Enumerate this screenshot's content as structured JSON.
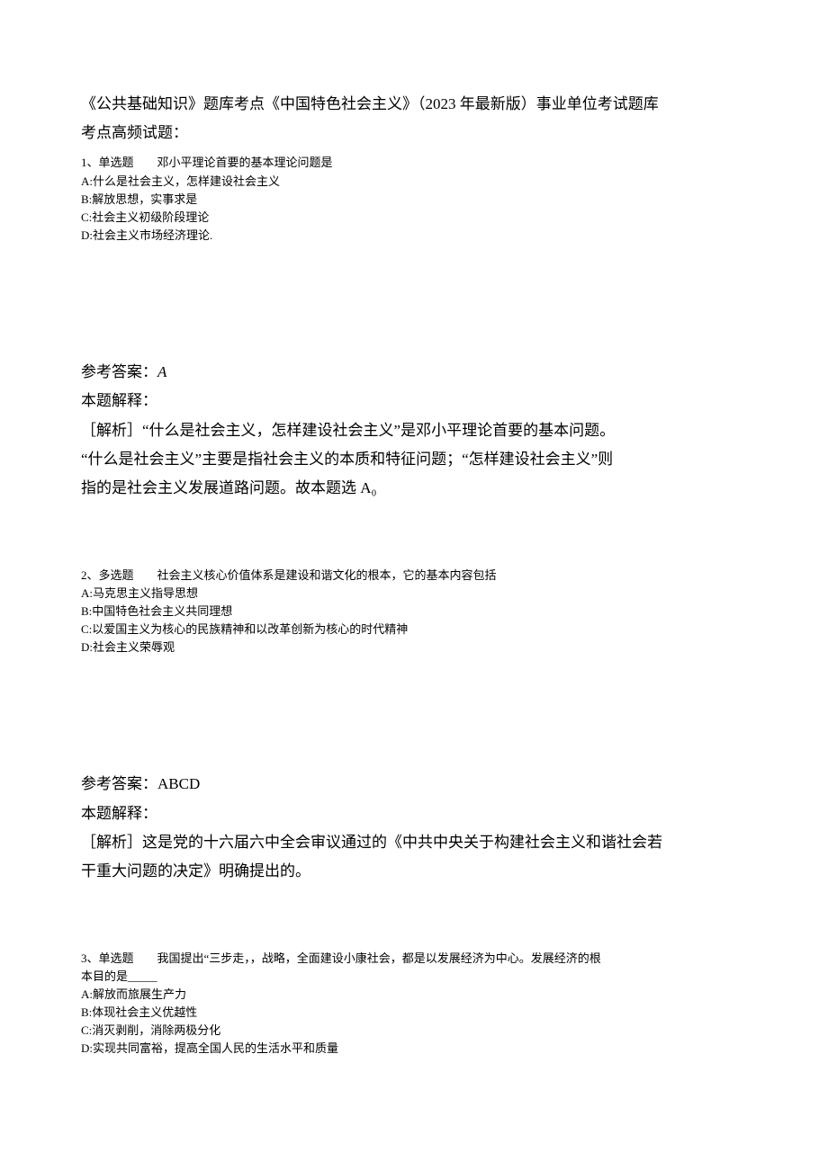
{
  "header": {
    "title_line1": "《公共基础知识》题库考点《中国特色社会主义》（2023 年最新版）事业单位考试题库",
    "title_line2": "考点高频试题："
  },
  "q1": {
    "stem": "1、单选题　　邓小平理论首要的基本理论问题是",
    "optA": "A:什么是社会主义，怎样建设社会主义",
    "optB": "B:解放思想，实事求是",
    "optC": "C:社会主义初级阶段理论",
    "optD": "D:社会主义市场经济理论.",
    "ans_label": "参考答案：",
    "ans_value": "A",
    "exp_label": "本题解释：",
    "exp_l1": "［解析］“什么是社会主义，怎样建设社会主义”是邓小平理论首要的基本问题。",
    "exp_l2": "“什么是社会主义”主要是指社会主义的本质和特征问题；“怎样建设社会主义”则",
    "exp_l3": "指的是社会主义发展道路问题。故本题选 A₀"
  },
  "q2": {
    "stem": "2、多选题　　社会主义核心价值体系是建设和谐文化的根本，它的基本内容包括",
    "optA": "A:马克思主义指导思想",
    "optB": "B:中国特色社会主义共同理想",
    "optC": "C:以爱国主义为核心的民族精神和以改革创新为核心的时代精神",
    "optD": "D:社会主义荣辱观",
    "ans_label": "参考答案：ABCD",
    "exp_label": "本题解释：",
    "exp_l1": "［解析］这是党的十六届六中全会审议通过的《中共中央关于构建社会主义和谐社会若",
    "exp_l2": "干重大问题的决定》明确提出的。"
  },
  "q3": {
    "stem_l1": "3、单选题　　我国提出“三步走，，战略，全面建设小康社会，都是以发展经济为中心。发展经济的根",
    "stem_l2": "本目的是_____",
    "optA": "A:解放而旅展生产力",
    "optB": "B:体现社会主义优越性",
    "optC": "C:消灭剥削，消除两极分化",
    "optD": "D:实现共同富裕，提高全国人民的生活水平和质量"
  }
}
